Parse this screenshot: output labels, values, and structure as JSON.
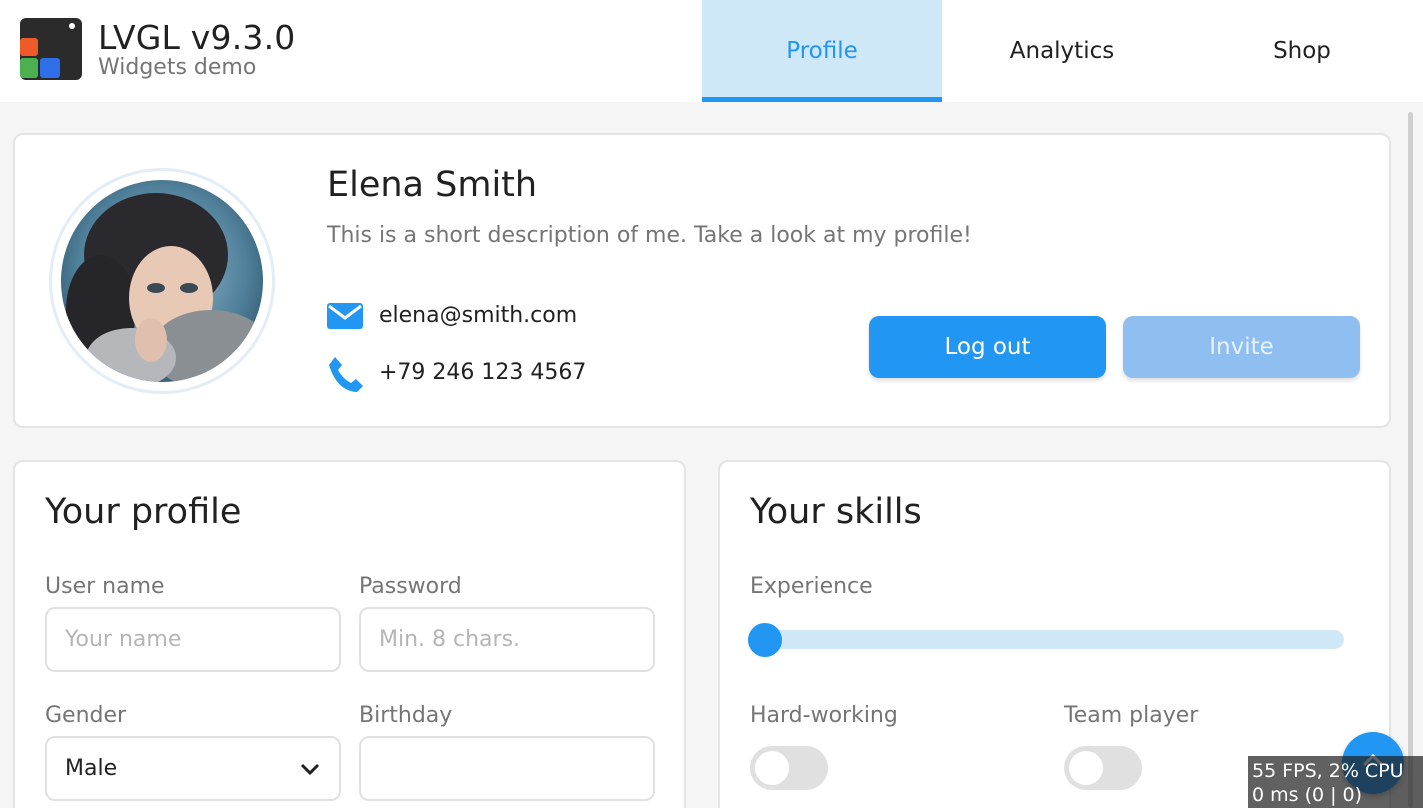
{
  "header": {
    "title": "LVGL v9.3.0",
    "subtitle": "Widgets demo",
    "logo_icon": "lvgl-logo-icon",
    "tabs": [
      {
        "label": "Profile",
        "active": true
      },
      {
        "label": "Analytics",
        "active": false
      },
      {
        "label": "Shop",
        "active": false
      }
    ]
  },
  "profile": {
    "name": "Elena Smith",
    "description": "This is a short description of me. Take a look at my profile!",
    "email": "elena@smith.com",
    "phone": "+79 246 123 4567",
    "email_icon": "envelope-icon",
    "phone_icon": "phone-icon",
    "logout_label": "Log out",
    "invite_label": "Invite"
  },
  "your_profile": {
    "title": "Your profile",
    "username_label": "User name",
    "username_placeholder": "Your name",
    "password_label": "Password",
    "password_placeholder": "Min. 8 chars.",
    "gender_label": "Gender",
    "gender_value": "Male",
    "birthday_label": "Birthday",
    "birthday_value": ""
  },
  "your_skills": {
    "title": "Your skills",
    "experience_label": "Experience",
    "experience_value": 0,
    "hard_working_label": "Hard-working",
    "hard_working_on": false,
    "team_player_label": "Team player",
    "team_player_on": false
  },
  "perf_monitor": {
    "line1": "55 FPS, 2% CPU",
    "line2": "0 ms (0 | 0)"
  },
  "colors": {
    "accent": "#2196f3",
    "tab_active_bg": "#cfe8f7",
    "invite_disabled": "#8ebff0"
  }
}
